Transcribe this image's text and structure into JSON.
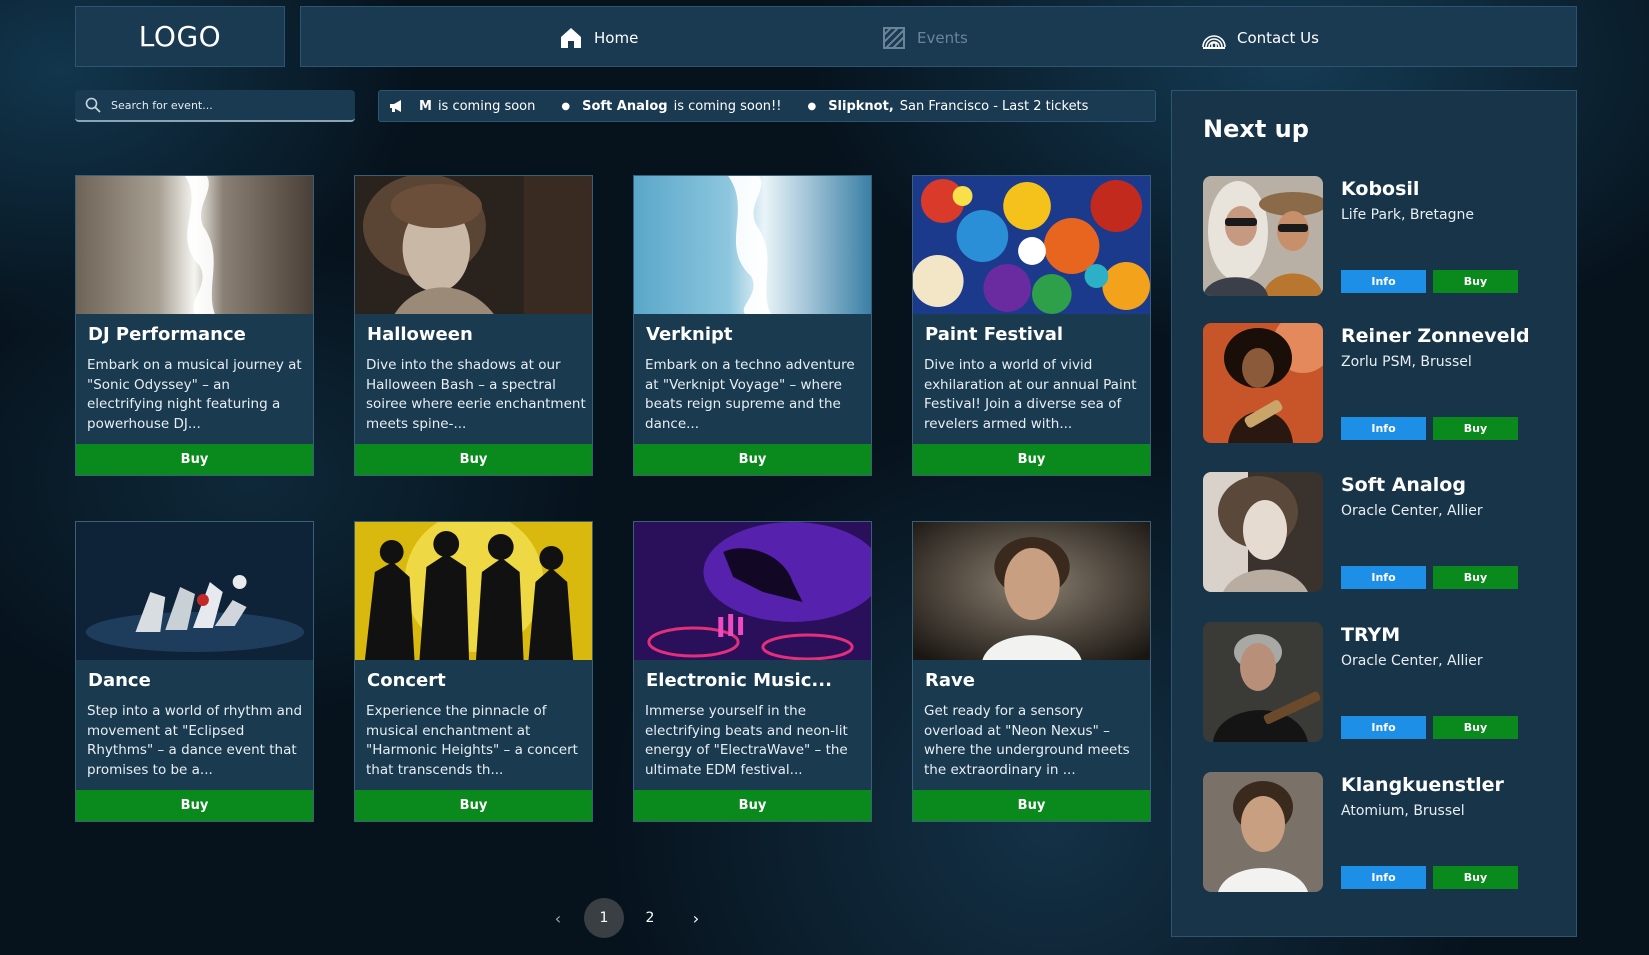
{
  "header": {
    "logo": "LOGO",
    "nav": [
      {
        "label": "Home",
        "icon": "home-icon"
      },
      {
        "label": "Events",
        "icon": "events-icon"
      },
      {
        "label": "Contact Us",
        "icon": "contact-icon"
      }
    ]
  },
  "search": {
    "placeholder": "Search for event..."
  },
  "ticker": [
    {
      "name": "M",
      "text": "is coming soon"
    },
    {
      "name": "Soft Analog",
      "text": "is coming soon!!"
    },
    {
      "name": "Slipknot,",
      "text": "San Francisco - Last 2 tickets"
    }
  ],
  "cards": [
    {
      "title": "DJ Performance",
      "desc": "Embark on a musical journey at \"Sonic Odyssey\" – an electrifying night featuring a powerhouse DJ...",
      "buy": "Buy"
    },
    {
      "title": "Halloween",
      "desc": "Dive into the shadows at our Halloween Bash – a spectral soiree where eerie enchantment meets spine-...",
      "buy": "Buy"
    },
    {
      "title": "Verknipt",
      "desc": "Embark on a techno adventure at \"Verknipt Voyage\" – where beats reign supreme and the dance...",
      "buy": "Buy"
    },
    {
      "title": "Paint Festival",
      "desc": "Dive into a world of vivid exhilaration at our annual Paint Festival! Join a diverse sea of revelers armed with...",
      "buy": "Buy"
    },
    {
      "title": "Dance",
      "desc": "Step into a world of rhythm and movement at \"Eclipsed Rhythms\" – a dance event that promises to be a...",
      "buy": "Buy"
    },
    {
      "title": "Concert",
      "desc": "Experience the pinnacle of musical enchantment at \"Harmonic Heights\" – a concert that transcends th...",
      "buy": "Buy"
    },
    {
      "title": "Electronic Music...",
      "desc": "Immerse yourself in the electrifying beats and neon-lit energy of \"ElectraWave\" – the ultimate EDM festival...",
      "buy": "Buy"
    },
    {
      "title": "Rave",
      "desc": "Get ready for a sensory overload at \"Neon Nexus\" – where the underground meets the extraordinary in ...",
      "buy": "Buy"
    }
  ],
  "pagination": {
    "prev": "‹",
    "pages": [
      "1",
      "2"
    ],
    "active": "1",
    "next": "›"
  },
  "sidebar": {
    "title": "Next up",
    "items": [
      {
        "name": "Kobosil",
        "location": "Life Park, Bretagne",
        "info": "Info",
        "buy": "Buy"
      },
      {
        "name": "Reiner Zonneveld",
        "location": "Zorlu PSM, Brussel",
        "info": "Info",
        "buy": "Buy"
      },
      {
        "name": "Soft Analog",
        "location": "Oracle Center, Allier",
        "info": "Info",
        "buy": "Buy"
      },
      {
        "name": "TRYM",
        "location": "Oracle Center, Allier",
        "info": "Info",
        "buy": "Buy"
      },
      {
        "name": "Klangkuenstler",
        "location": "Atomium, Brussel",
        "info": "Info",
        "buy": "Buy"
      }
    ]
  },
  "colors": {
    "buy_green": "#0a8a1c",
    "info_blue": "#1e8fe6",
    "panel": "#1a3a52"
  }
}
